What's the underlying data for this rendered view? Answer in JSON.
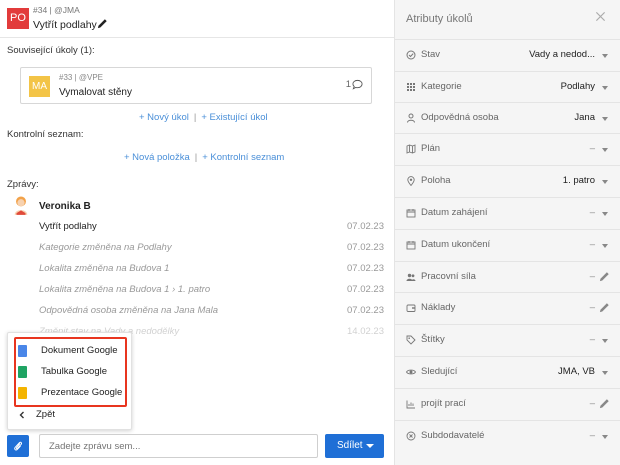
{
  "task": {
    "badge": "PO",
    "meta": "#34 | @JMA",
    "title": "Vytřít podlahy"
  },
  "related": {
    "label": "Související úkoly (1):",
    "card": {
      "badge": "MA",
      "meta": "#33 | @VPE",
      "title": "Vymalovat stěny",
      "comment_count": "1"
    },
    "links": {
      "new": "+ Nový úkol",
      "sep": "|",
      "existing": "+ Existující úkol"
    }
  },
  "checklist": {
    "label": "Kontrolní seznam:",
    "links": {
      "new": "+ Nová položka",
      "sep": "|",
      "existing": "+ Kontrolní seznam"
    }
  },
  "messages": {
    "label": "Zprávy:",
    "author": "Veronika B",
    "items": [
      {
        "text": "Vytřít podlahy",
        "date": "07.02.23",
        "kind": "main"
      },
      {
        "text": "Kategorie změněna na Podlahy",
        "date": "07.02.23",
        "kind": "sys"
      },
      {
        "text": "Lokalita změněna na Budova 1",
        "date": "07.02.23",
        "kind": "sys"
      },
      {
        "text": "Lokalita změněna na Budova 1 › 1. patro",
        "date": "07.02.23",
        "kind": "sys"
      },
      {
        "text": "Odpovědná osoba změněna na Jana Mala",
        "date": "07.02.23",
        "kind": "sys"
      },
      {
        "text": "Změnit stav na Vady a nedodělky",
        "date": "14.02.23",
        "kind": "sys"
      }
    ]
  },
  "popup": {
    "items": [
      {
        "label": "Dokument Google",
        "icon": "google-docs-icon",
        "color": "#4a86e8"
      },
      {
        "label": "Tabulka Google",
        "icon": "google-sheets-icon",
        "color": "#1fa463"
      },
      {
        "label": "Prezentace Google",
        "icon": "google-slides-icon",
        "color": "#f4b400"
      }
    ],
    "back": "Zpět",
    "highlight_color": "#e8351f"
  },
  "composer": {
    "placeholder": "Zadejte zprávu sem...",
    "share": "Sdílet"
  },
  "attributes": {
    "title": "Atributy úkolů",
    "rows": [
      {
        "icon": "status-icon",
        "label": "Stav",
        "value": "Vady a nedod...",
        "control": "caret"
      },
      {
        "icon": "category-icon",
        "label": "Kategorie",
        "value": "Podlahy",
        "control": "caret"
      },
      {
        "icon": "person-icon",
        "label": "Odpovědná osoba",
        "value": "Jana",
        "control": "caret"
      },
      {
        "icon": "map-icon",
        "label": "Plán",
        "value": "–",
        "control": "caret"
      },
      {
        "icon": "location-icon",
        "label": "Poloha",
        "value": "1. patro",
        "control": "caret"
      },
      {
        "icon": "calendar-icon",
        "label": "Datum zahájení",
        "value": "–",
        "control": "caret"
      },
      {
        "icon": "calendar-icon",
        "label": "Datum ukončení",
        "value": "–",
        "control": "caret"
      },
      {
        "icon": "people-icon",
        "label": "Pracovní síla",
        "value": "–",
        "control": "pencil"
      },
      {
        "icon": "costs-icon",
        "label": "Náklady",
        "value": "–",
        "control": "pencil"
      },
      {
        "icon": "tag-icon",
        "label": "Štítky",
        "value": "–",
        "control": "caret"
      },
      {
        "icon": "eye-icon",
        "label": "Sledující",
        "value": "JMA, VB",
        "control": "caret"
      },
      {
        "icon": "work-icon",
        "label": "projít prací",
        "value": "–",
        "control": "pencil"
      },
      {
        "icon": "subcontractor-icon",
        "label": "Subdodavatelé",
        "value": "–",
        "control": "caret"
      }
    ]
  },
  "colors": {
    "accent": "#1f6fd6",
    "link": "#4a8fd8",
    "task_badge": "#e23b3b",
    "related_badge": "#f3c447"
  }
}
